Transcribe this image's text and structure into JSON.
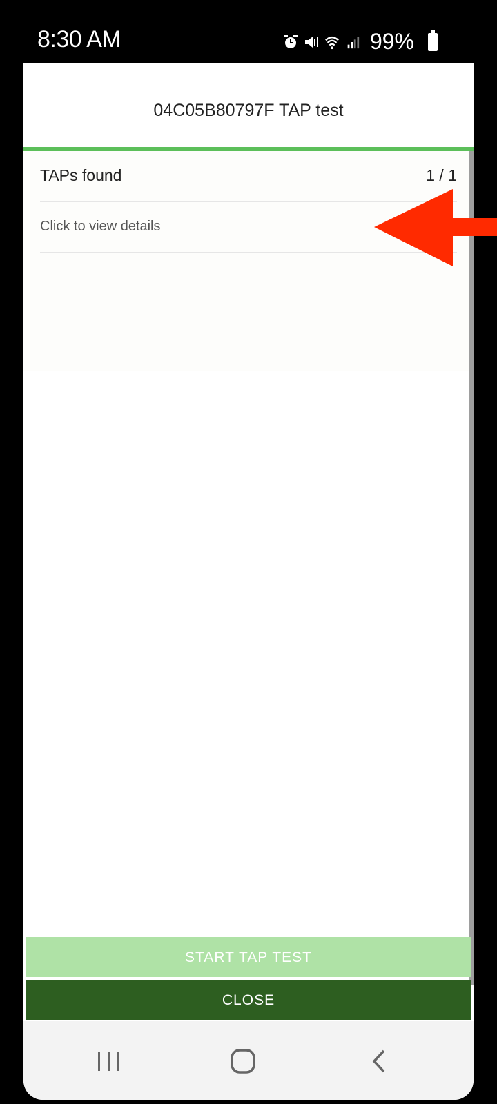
{
  "status_bar": {
    "time": "8:30 AM",
    "battery_percent": "99%",
    "icons": [
      "alarm-icon",
      "mute-icon",
      "wifi-icon",
      "signal-icon",
      "battery-icon"
    ]
  },
  "header": {
    "title": "04C05B80797F TAP test"
  },
  "progress": {
    "fraction": 1.0,
    "color": "#5cbf5a"
  },
  "taps": {
    "label": "TAPs found",
    "count": "1 / 1",
    "details_link": "Click to view details"
  },
  "buttons": {
    "start": "START TAP TEST",
    "start_color": "#afe2a6",
    "close": "CLOSE",
    "close_color": "#2d5e20"
  },
  "nav": {
    "icons": [
      "recent-apps-icon",
      "home-icon",
      "back-icon"
    ]
  },
  "annotation": {
    "arrow_color": "#ff2a00",
    "icon": "red-arrow-icon"
  }
}
